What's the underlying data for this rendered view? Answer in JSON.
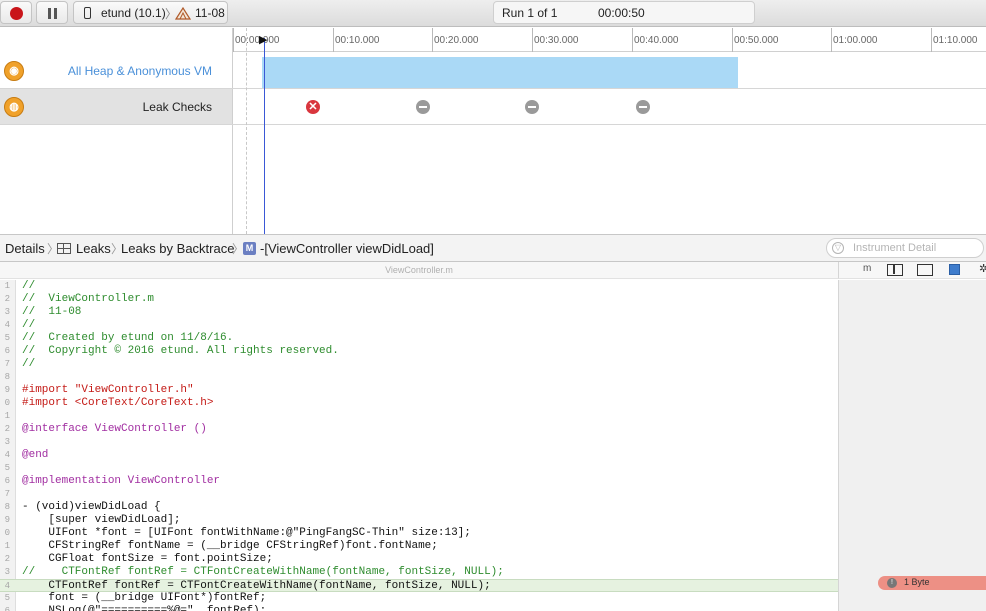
{
  "toolbar": {
    "device": "etund (10.1)",
    "separator": "〉",
    "project": "11-08",
    "run": "Run 1 of 1",
    "elapsed": "00:00:50"
  },
  "timeline": {
    "ticks": [
      "00:00.000",
      "00:10.000",
      "00:20.000",
      "00:30.000",
      "00:40.000",
      "00:50.000",
      "01:00.000",
      "01:10.000"
    ]
  },
  "instruments": {
    "heap_label": "All Heap & Anonymous VM",
    "leaks_label": "Leak Checks",
    "leak_check_marks": [
      "leak",
      "none",
      "none",
      "none"
    ],
    "colors": {
      "heap_bar": "#aad9f6",
      "leak": "#d9363e",
      "no_leak": "#9a9a9a",
      "playhead": "#3a58d6"
    }
  },
  "jumpbar": {
    "details": "Details",
    "leaks": "Leaks",
    "by_backtrace": "Leaks by Backtrace",
    "method": "-[ViewController viewDidLoad]",
    "filter_placeholder": "Instrument Detail"
  },
  "editor": {
    "filename": "ViewController.m",
    "side_m": "m",
    "leak_badge": "1 Byte",
    "lines": [
      {
        "n": "1",
        "t": "//",
        "c": "comment"
      },
      {
        "n": "2",
        "t": "//  ViewController.m",
        "c": "comment"
      },
      {
        "n": "3",
        "t": "//  11-08",
        "c": "comment"
      },
      {
        "n": "4",
        "t": "//",
        "c": "comment"
      },
      {
        "n": "5",
        "t": "//  Created by etund on 11/8/16.",
        "c": "comment"
      },
      {
        "n": "6",
        "t": "//  Copyright © 2016 etund. All rights reserved.",
        "c": "comment"
      },
      {
        "n": "7",
        "t": "//",
        "c": "comment"
      },
      {
        "n": "8",
        "t": "",
        "c": "plain"
      },
      {
        "n": "9",
        "t": "#import \"ViewController.h\"",
        "c": "import"
      },
      {
        "n": "0",
        "t": "#import <CoreText/CoreText.h>",
        "c": "import"
      },
      {
        "n": "1",
        "t": "",
        "c": "plain"
      },
      {
        "n": "2",
        "t": "@interface ViewController ()",
        "c": "directive"
      },
      {
        "n": "3",
        "t": "",
        "c": "plain"
      },
      {
        "n": "4",
        "t": "@end",
        "c": "kw"
      },
      {
        "n": "5",
        "t": "",
        "c": "plain"
      },
      {
        "n": "6",
        "t": "@implementation ViewController",
        "c": "directive"
      },
      {
        "n": "7",
        "t": "",
        "c": "plain"
      },
      {
        "n": "8",
        "t": "- (void)viewDidLoad {",
        "c": "plain"
      },
      {
        "n": "9",
        "t": "    [super viewDidLoad];",
        "c": "plain"
      },
      {
        "n": "0",
        "t": "    UIFont *font = [UIFont fontWithName:@\"PingFangSC-Thin\" size:13];",
        "c": "plain"
      },
      {
        "n": "1",
        "t": "    CFStringRef fontName = (__bridge CFStringRef)font.fontName;",
        "c": "plain"
      },
      {
        "n": "2",
        "t": "    CGFloat fontSize = font.pointSize;",
        "c": "plain"
      },
      {
        "n": "3",
        "t": "//    CTFontRef fontRef = CTFontCreateWithName(fontName, fontSize, NULL);",
        "c": "comment"
      },
      {
        "n": "4",
        "t": "    CTFontRef fontRef = CTFontCreateWithName(fontName, fontSize, NULL);",
        "c": "highlight"
      },
      {
        "n": "5",
        "t": "    font = (__bridge UIFont*)fontRef;",
        "c": "plain"
      },
      {
        "n": "6",
        "t": "    NSLog(@\"==========%@=\", fontRef);",
        "c": "plain"
      }
    ]
  }
}
